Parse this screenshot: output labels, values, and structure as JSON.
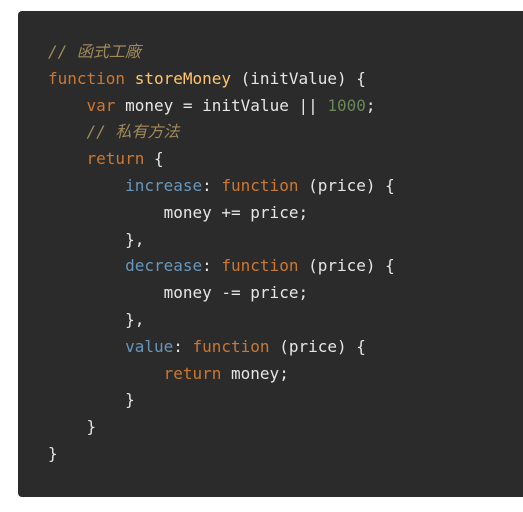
{
  "colors": {
    "background": "#2b2b2b",
    "keyword": "#cc7832",
    "function_name": "#ffc66d",
    "comment": "#a08a5a",
    "number": "#6a8759",
    "property": "#6897bb",
    "text": "#e6e6e6"
  },
  "code": {
    "line1": {
      "comment": "// 函式工廠"
    },
    "line2": {
      "kw_function": "function",
      "space1": " ",
      "name": "storeMoney",
      "rest": " (initValue) {"
    },
    "line3": {
      "indent": "    ",
      "kw_var": "var",
      "mid": " money = initValue || ",
      "number": "1000",
      "end": ";"
    },
    "line4": {
      "indent": "    ",
      "comment": "// 私有方法"
    },
    "line5": {
      "indent": "    ",
      "kw_return": "return",
      "rest": " {"
    },
    "line6": {
      "indent": "        ",
      "prop": "increase",
      "colon": ": ",
      "kw_function": "function",
      "rest": " (price) {"
    },
    "line7": {
      "indent": "            ",
      "text": "money += price;"
    },
    "line8": {
      "indent": "        ",
      "text": "},"
    },
    "line9": {
      "indent": "        ",
      "prop": "decrease",
      "colon": ": ",
      "kw_function": "function",
      "rest": " (price) {"
    },
    "line10": {
      "indent": "            ",
      "text": "money -= price;"
    },
    "line11": {
      "indent": "        ",
      "text": "},"
    },
    "line12": {
      "indent": "        ",
      "prop": "value",
      "colon": ": ",
      "kw_function": "function",
      "rest": " (price) {"
    },
    "line13": {
      "indent": "            ",
      "kw_return": "return",
      "rest": " money;"
    },
    "line14": {
      "indent": "        ",
      "text": "}"
    },
    "line15": {
      "indent": "    ",
      "text": "}"
    },
    "line16": {
      "text": "}"
    }
  }
}
